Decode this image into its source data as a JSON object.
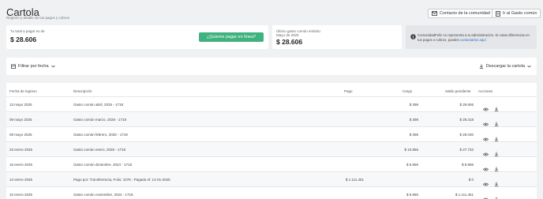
{
  "header": {
    "title": "Cartola",
    "subtitle": "Registro y detalle de tus pagos y cobros",
    "contact_label": "Contacto de la comunidad",
    "goto_label": "Ir al Gasto común"
  },
  "summary": {
    "total_label": "Tu total a pagar es de",
    "total_amount": "$ 28.606",
    "pay_label": "¿Quieres pagar en línea?",
    "last_label": "Último gasto común emitido:",
    "last_period": "Mayo de 2025",
    "last_amount": "$ 28.606"
  },
  "info": {
    "text": "ComunidadFeliz no representa a tu administración. Si notas diferencias en tus pagos o cobros, puedes ",
    "link": "contactarlos aquí"
  },
  "toolbar": {
    "filter_label": "Filtrar por fecha",
    "download_label": "Descargar la cartola"
  },
  "table": {
    "headers": {
      "date": "Fecha de ingreso",
      "desc": "Descripción",
      "payment": "Pago",
      "charge": "Cargo",
      "balance": "Saldo pendiente",
      "actions": "Acciones"
    },
    "rows": [
      {
        "date": "13 mayo 2025",
        "desc": "Gasto común abril, 2025 - 1718",
        "payment": "",
        "charge": "$ 398",
        "balance": "$ 28.606"
      },
      {
        "date": "09 mayo 2025",
        "desc": "Gasto común marzo, 2025 - 1718",
        "payment": "",
        "charge": "$ 398",
        "balance": "$ 28.318"
      },
      {
        "date": "08 mayo 2025",
        "desc": "Gasto común febrero, 2025 - 1718",
        "payment": "",
        "charge": "$ 398",
        "balance": "$ 28.030"
      },
      {
        "date": "23 enero 2025",
        "desc": "Gasto común enero, 2025 - 1718",
        "payment": "",
        "charge": "$ 10.866",
        "balance": "$ 27.732"
      },
      {
        "date": "16 enero 2025",
        "desc": "Gasto común diciembre, 2024 - 1718",
        "payment": "",
        "charge": "$ 8.866",
        "balance": "$ 8.866"
      },
      {
        "date": "14 enero 2025",
        "desc": "Pago por: Transferencia, Folio: 1076 - Pagado el: 14-01-2025",
        "payment": "$ 1.111.451",
        "charge": "",
        "balance": "$ 0"
      },
      {
        "date": "10 enero 2025",
        "desc": "Gasto común noviembre, 2024 - 1718",
        "payment": "",
        "charge": "$ 8.866",
        "balance": "$ 1.111.451"
      }
    ]
  }
}
